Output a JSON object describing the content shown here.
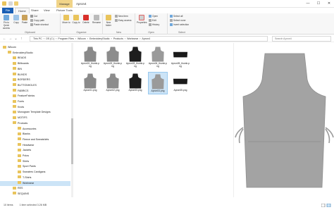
{
  "window": {
    "title": "Apron4",
    "contextual_tab": "Manage",
    "minimize": "—",
    "maximize": "☐",
    "close": "✕"
  },
  "ribbon_tabs": [
    "File",
    "Home",
    "Share",
    "View",
    "Picture Tools"
  ],
  "ribbon": {
    "clipboard": {
      "pin": "Pin to Quick access",
      "copy": "Copy",
      "paste": "Paste",
      "cut": "Cut",
      "copy_path": "Copy path",
      "paste_shortcut": "Paste shortcut",
      "label": "Clipboard"
    },
    "organize": {
      "move_to": "Move to",
      "copy_to": "Copy to",
      "delete": "Delete",
      "rename": "Rename",
      "label": "Organize"
    },
    "new": {
      "new_folder": "New folder",
      "new_item": "New item",
      "easy_access": "Easy access",
      "label": "New"
    },
    "open": {
      "properties": "Properties",
      "open": "Open",
      "edit": "Edit",
      "history": "History",
      "label": "Open"
    },
    "select": {
      "select_all": "Select all",
      "select_none": "Select none",
      "invert": "Invert selection",
      "label": "Select"
    }
  },
  "address": {
    "crumbs": [
      "This PC",
      "OS (C:)",
      "Program Files",
      "Wilcom",
      "EmbroideryStudio",
      "Products",
      "Workwear",
      "Apron4"
    ],
    "search_placeholder": "Search Apron4"
  },
  "nav": {
    "items": [
      {
        "label": "Wilcom",
        "indent": 0
      },
      {
        "label": "EmbroideryStudio",
        "indent": 1
      },
      {
        "label": "BEADS",
        "indent": 2
      },
      {
        "label": "Billboards",
        "indent": 2
      },
      {
        "label": "BIN",
        "indent": 2
      },
      {
        "label": "BLINDS",
        "indent": 2
      },
      {
        "label": "BORDERS",
        "indent": 2
      },
      {
        "label": "BUTTONHOLES",
        "indent": 2
      },
      {
        "label": "FABRICS",
        "indent": 2
      },
      {
        "label": "FeatureFabrics",
        "indent": 2
      },
      {
        "label": "Fonts",
        "indent": 2
      },
      {
        "label": "Knots",
        "indent": 2
      },
      {
        "label": "Monogram Template Designs",
        "indent": 2
      },
      {
        "label": "MOTIFS",
        "indent": 2
      },
      {
        "label": "Products",
        "indent": 2
      },
      {
        "label": "Accessories",
        "indent": 3
      },
      {
        "label": "Blanks",
        "indent": 3
      },
      {
        "label": "Fleece and Sweatshirts",
        "indent": 3
      },
      {
        "label": "Headwear",
        "indent": 3
      },
      {
        "label": "Jackets",
        "indent": 3
      },
      {
        "label": "Polos",
        "indent": 3
      },
      {
        "label": "Shirts",
        "indent": 3
      },
      {
        "label": "Sport Pants",
        "indent": 3
      },
      {
        "label": "Sweaters Cardigans",
        "indent": 3
      },
      {
        "label": "T-Shirts",
        "indent": 3
      },
      {
        "label": "Workwear",
        "indent": 3,
        "selected": true
      },
      {
        "label": "RES",
        "indent": 2
      },
      {
        "label": "SEQUINS",
        "indent": 2
      }
    ]
  },
  "files": [
    {
      "name": "Apron01_thumb.png",
      "shape": "apron",
      "color": "#8a8a8a"
    },
    {
      "name": "Apron02_thumb.png",
      "shape": "apron",
      "color": "#8c8c8c"
    },
    {
      "name": "Apron03_thumb.png",
      "shape": "apron",
      "color": "#1e1e1e"
    },
    {
      "name": "Apron04_thumb.png",
      "shape": "apron",
      "color": "#9a9a9a"
    },
    {
      "name": "Apron05_thumb.png",
      "shape": "waist",
      "color": "#1a1a1a"
    },
    {
      "name": "Apron01.png",
      "shape": "apron",
      "color": "#8a8a8a"
    },
    {
      "name": "Apron02.png",
      "shape": "apron",
      "color": "#8c8c8c"
    },
    {
      "name": "Apron03.png",
      "shape": "apron",
      "color": "#1e1e1e"
    },
    {
      "name": "Apron04.png",
      "shape": "apron",
      "color": "#9a9a9a",
      "selected": true
    },
    {
      "name": "Apron05.png",
      "shape": "waist",
      "color": "#1a1a1a"
    }
  ],
  "preview": {
    "color": "#a3a3a3"
  },
  "status": {
    "count": "10 items",
    "selection": "1 item selected  3.26 MB"
  },
  "colors": {
    "file_tab": "#1a5fb4",
    "selection": "#cce4f7",
    "folder": "#e9c45c",
    "manage": "#f1d488"
  }
}
